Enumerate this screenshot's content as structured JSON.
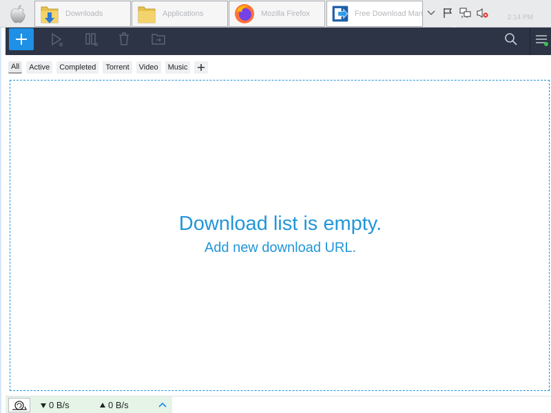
{
  "taskbar": {
    "tasks": [
      {
        "name": "downloads-folder",
        "label": "Downloads"
      },
      {
        "name": "applications-folder",
        "label": "Applications"
      },
      {
        "name": "firefox",
        "label": "Mozilla Firefox"
      },
      {
        "name": "free-download-manager",
        "label": "Free Download Manager"
      }
    ],
    "clock": "2:14 PM"
  },
  "toolbar": {
    "icons": [
      "add-download-icon",
      "resume-icon",
      "pause-icon",
      "delete-icon",
      "move-to-folder-icon",
      "search-icon",
      "menu-icon"
    ],
    "accent": "#1e90e6",
    "background": "#2d3445"
  },
  "filters": {
    "tabs": [
      "All",
      "Active",
      "Completed",
      "Torrent",
      "Video",
      "Music"
    ],
    "selected": "All"
  },
  "empty_state": {
    "title": "Download list is empty.",
    "subtitle": "Add new download URL.",
    "color": "#2196d8"
  },
  "statusbar": {
    "download_speed": "0 B/s",
    "upload_speed": "0 B/s",
    "background": "#e5f4e7"
  }
}
